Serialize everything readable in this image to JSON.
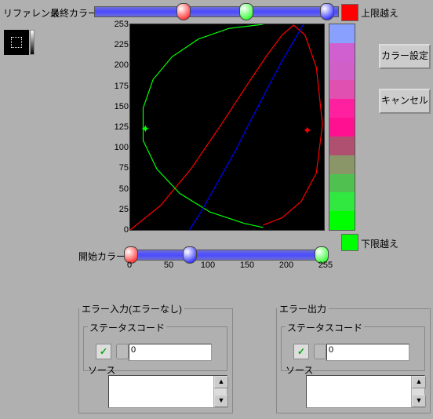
{
  "labels": {
    "reference": "リファレンス",
    "finalColor": "最終カラー",
    "startColor": "開始カラー",
    "overUpper": "上限越え",
    "overLower": "下限越え"
  },
  "buttons": {
    "colorSet": "カラー設定",
    "cancel": "キャンセル"
  },
  "overColors": {
    "upper": "#ff0000",
    "lower": "#00ff00"
  },
  "topThumbs": [
    {
      "pos": 36,
      "color": "#ff0000"
    },
    {
      "pos": 62,
      "color": "#00ff00"
    },
    {
      "pos": 95,
      "color": "#0000ff"
    }
  ],
  "botThumbs": [
    {
      "pos": 0,
      "color": "#ff0000"
    },
    {
      "pos": 30,
      "color": "#0000ff"
    },
    {
      "pos": 97,
      "color": "#00ff00"
    }
  ],
  "yTicks": [
    "253",
    "225",
    "200",
    "175",
    "150",
    "125",
    "100",
    "75",
    "50",
    "25",
    "0"
  ],
  "xTicks": [
    "0",
    "50",
    "100",
    "150",
    "200",
    "255"
  ],
  "colorbar": [
    "#8aa0ff",
    "#d060d0",
    "#d060c8",
    "#e050b0",
    "#ff20a0",
    "#ff1090",
    "#b05070",
    "#8a9668",
    "#50c050",
    "#30e840",
    "#00ff00"
  ],
  "chart_data": {
    "type": "line",
    "xlim": [
      0,
      255
    ],
    "ylim": [
      0,
      253
    ],
    "xlabel": "",
    "ylabel": "",
    "series": [
      {
        "name": "red",
        "color": "#ff0000",
        "marker": [
          233,
          123
        ],
        "points": [
          [
            0,
            0
          ],
          [
            40,
            30
          ],
          [
            80,
            75
          ],
          [
            120,
            130
          ],
          [
            155,
            180
          ],
          [
            180,
            215
          ],
          [
            200,
            240
          ],
          [
            215,
            252
          ],
          [
            230,
            240
          ],
          [
            245,
            200
          ],
          [
            253,
            130
          ],
          [
            245,
            70
          ],
          [
            225,
            35
          ],
          [
            200,
            15
          ],
          [
            175,
            6
          ]
        ]
      },
      {
        "name": "green",
        "color": "#00ff00",
        "marker": [
          20,
          125
        ],
        "points": [
          [
            175,
            253
          ],
          [
            130,
            248
          ],
          [
            90,
            235
          ],
          [
            55,
            213
          ],
          [
            30,
            185
          ],
          [
            17,
            150
          ],
          [
            17,
            110
          ],
          [
            35,
            75
          ],
          [
            65,
            45
          ],
          [
            105,
            22
          ],
          [
            150,
            8
          ],
          [
            175,
            3
          ]
        ]
      },
      {
        "name": "blue",
        "color": "#0000ff",
        "points": [
          [
            78,
            0
          ],
          [
            95,
            25
          ],
          [
            110,
            50
          ],
          [
            125,
            75
          ],
          [
            140,
            100
          ],
          [
            155,
            128
          ],
          [
            170,
            155
          ],
          [
            185,
            182
          ],
          [
            200,
            208
          ],
          [
            215,
            232
          ],
          [
            228,
            253
          ]
        ]
      }
    ]
  },
  "errorIn": {
    "legend": "エラー入力(エラーなし)",
    "status": "ステータスコード",
    "source": "ソース",
    "code": "0"
  },
  "errorOut": {
    "legend": "エラー出力",
    "status": "ステータスコード",
    "source": "ソース",
    "code": "0"
  }
}
